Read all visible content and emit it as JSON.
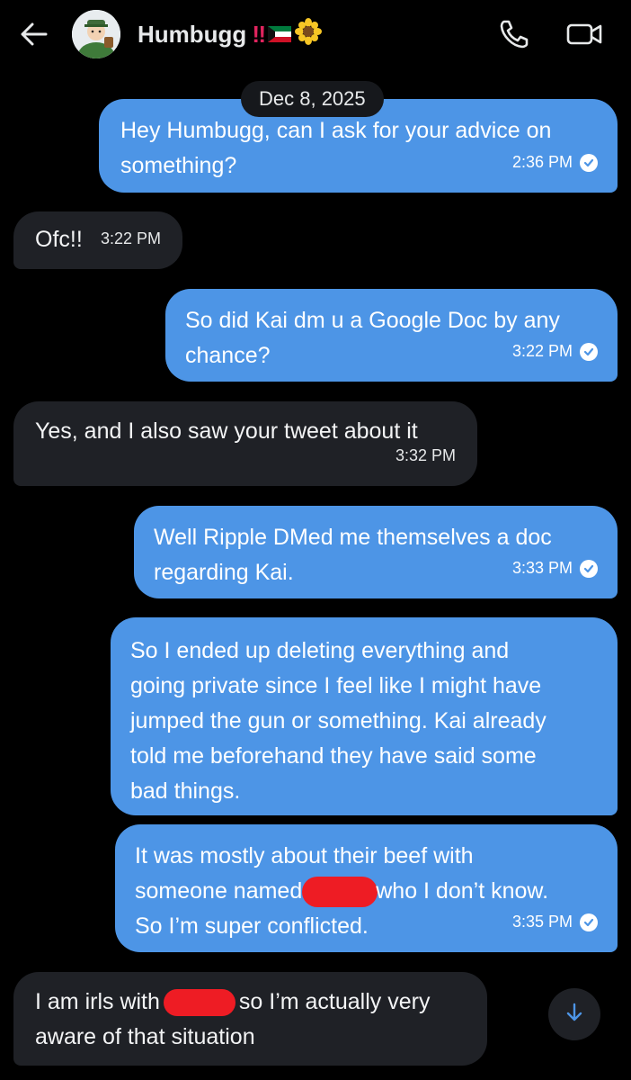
{
  "header": {
    "contact_name": "Humbugg",
    "name_flair": "‼",
    "flag_icon": "kuwait-flag-icon",
    "flower_icon": "sunflower-icon",
    "back_icon": "back-arrow-icon",
    "call_icon": "phone-icon",
    "video_icon": "video-camera-icon"
  },
  "date_divider": "Dec 8, 2025",
  "messages": [
    {
      "side": "sent",
      "lines": [
        "Hey Humbugg, can I ask for your advice on",
        "something?"
      ],
      "time": "2:36 PM",
      "read": true
    },
    {
      "side": "received",
      "lines": [
        "Ofc!!"
      ],
      "time": "3:22 PM"
    },
    {
      "side": "sent",
      "lines": [
        "So did Kai dm u a Google Doc by any",
        "chance?"
      ],
      "time": "3:22 PM",
      "read": true
    },
    {
      "side": "received",
      "lines": [
        "Yes, and I also saw your tweet about it"
      ],
      "time": "3:32 PM"
    },
    {
      "side": "sent",
      "lines": [
        "Well Ripple DMed me themselves a doc",
        "regarding Kai."
      ],
      "time": "3:33 PM",
      "read": true
    },
    {
      "side": "sent",
      "lines": [
        "So I ended up deleting everything and",
        "going private since I feel like I might have",
        "jumped the gun or something. Kai already",
        "told me beforehand they have said some",
        "bad things."
      ]
    },
    {
      "side": "sent",
      "lines": [
        "It was mostly about their beef with",
        "someone named",
        "who I don’t know.",
        "So I’m super conflicted."
      ],
      "time": "3:35 PM",
      "read": true
    },
    {
      "side": "received",
      "lines": [
        "I am irls with",
        "so I’m actually very",
        "aware of that situation"
      ]
    }
  ],
  "scroll_down_icon": "arrow-down-icon",
  "colors": {
    "background": "#000000",
    "sent_bubble": "#4d95e6",
    "received_bubble": "#1f2126",
    "redaction": "#ee1c24"
  }
}
